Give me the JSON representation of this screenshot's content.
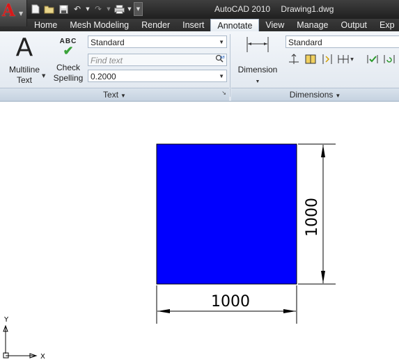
{
  "app": {
    "title": "AutoCAD 2010",
    "document": "Drawing1.dwg",
    "logo_letter": "A"
  },
  "quick_access": {
    "icons": [
      "new-icon",
      "open-icon",
      "save-icon",
      "undo-icon",
      "redo-icon",
      "plot-icon"
    ]
  },
  "tabs": [
    {
      "label": "Home",
      "active": false
    },
    {
      "label": "Mesh Modeling",
      "active": false
    },
    {
      "label": "Render",
      "active": false
    },
    {
      "label": "Insert",
      "active": false
    },
    {
      "label": "Annotate",
      "active": true
    },
    {
      "label": "View",
      "active": false
    },
    {
      "label": "Manage",
      "active": false
    },
    {
      "label": "Output",
      "active": false
    },
    {
      "label": "Exp",
      "active": false
    }
  ],
  "text_panel": {
    "multiline_text_line1": "Multiline",
    "multiline_text_line2": "Text",
    "check_spelling_line1": "Check",
    "check_spelling_line2": "Spelling",
    "check_glyph": "ABC",
    "text_style": "Standard",
    "find_text_placeholder": "Find text",
    "text_height": "0.2000",
    "footer": "Text"
  },
  "dimensions_panel": {
    "dimension_label": "Dimension",
    "dim_style": "Standard",
    "footer": "Dimensions"
  },
  "drawing": {
    "rectangle_color": "#0000ff",
    "horizontal_dimension": "1000",
    "vertical_dimension": "1000",
    "ucs_x": "X",
    "ucs_y": "Y"
  }
}
